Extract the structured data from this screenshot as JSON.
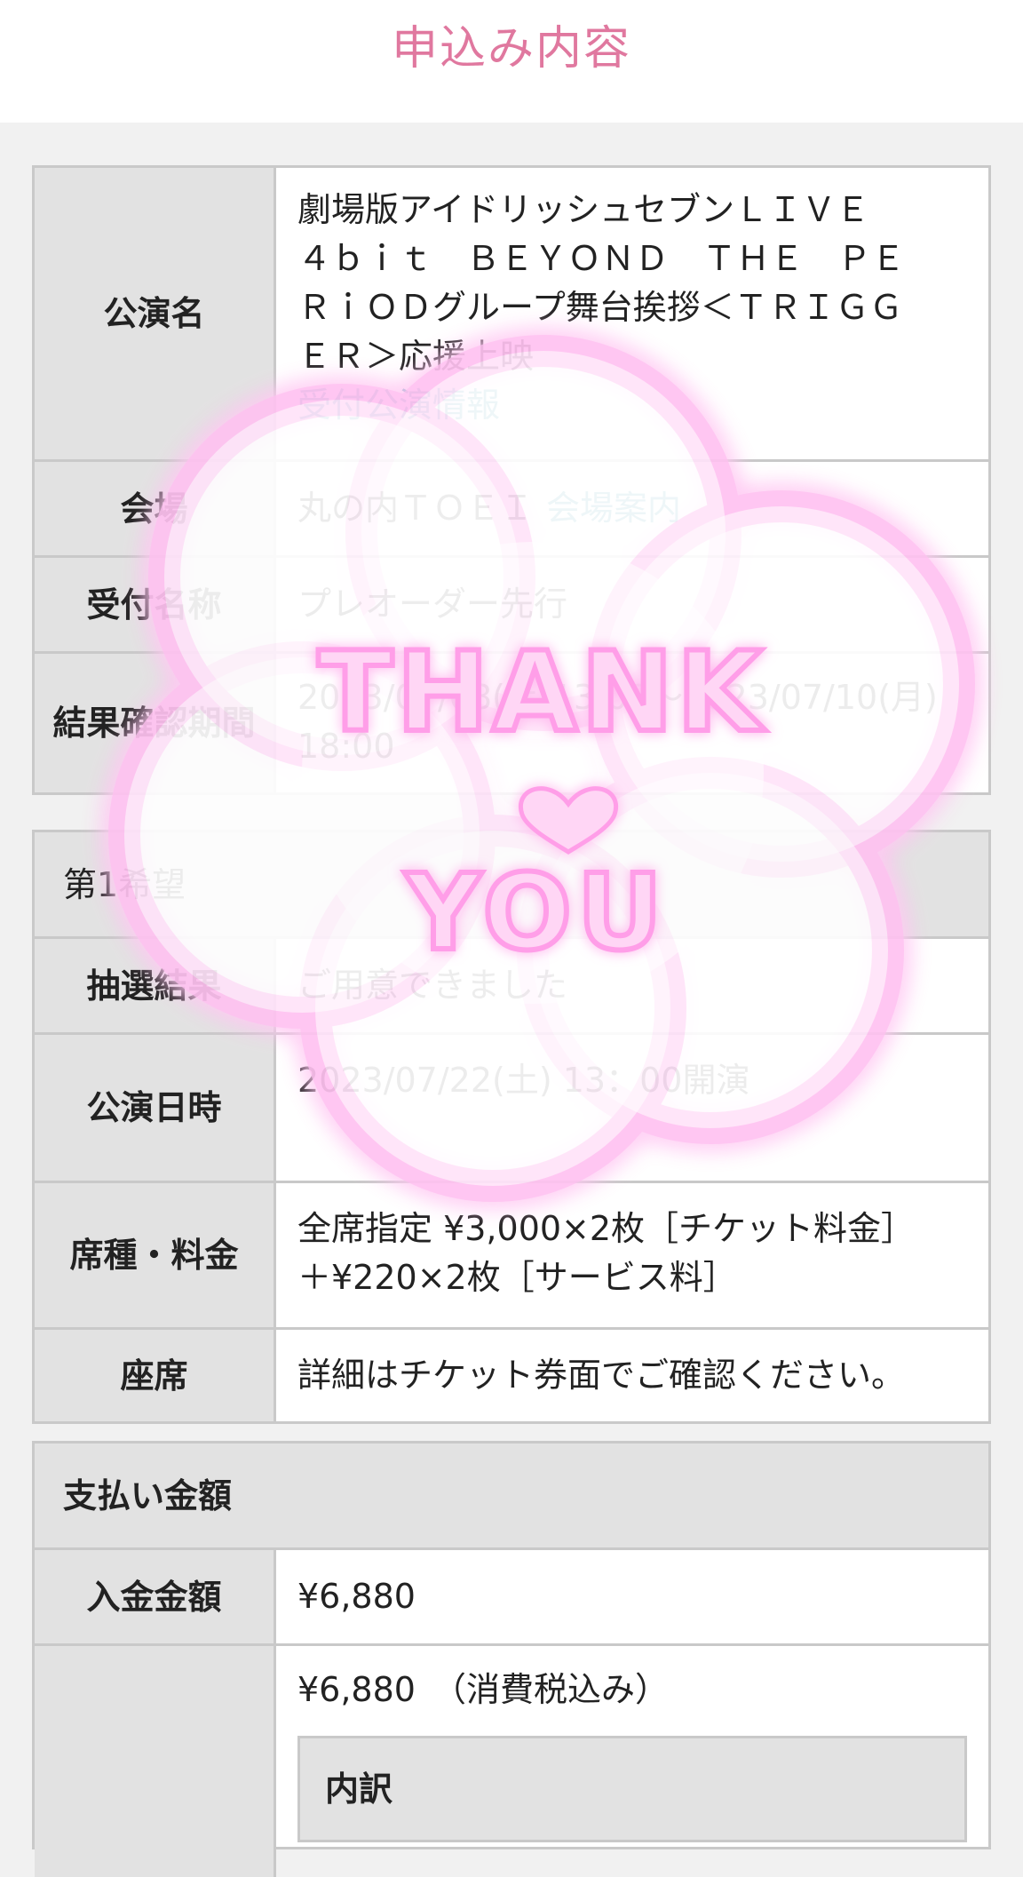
{
  "header": {
    "title": "申込み内容"
  },
  "event": {
    "title_label": "公演名",
    "title_line1": "劇場版アイドリッシュセブンＬＩＶＥ",
    "title_line2": "４ｂｉｔ　ＢＥＹＯＮＤ　ＴＨＥ　ＰＥ",
    "title_line3": "ＲｉＯＤグループ舞台挨拶＜ＴＲＩＧＧ",
    "title_line4": "ＥＲ＞応援上映",
    "detail_link": "受付公演情報",
    "venue_label": "会場",
    "venue_value": "丸の内ＴＯＥＩ",
    "venue_link": "会場案内",
    "reception_label": "受付名称",
    "reception_value": "プレオーダー先行",
    "result_label": "結果確認期間",
    "result_value_line1": "2023/07/08(土)13:00～2023/07/10(月)",
    "result_value_line2": "18:00"
  },
  "choice": {
    "heading": "第1希望",
    "lottery_label": "抽選結果",
    "lottery_value": "ご用意できました",
    "datetime_label": "公演日時",
    "datetime_value": "2023/07/22(土) 13：00開演",
    "seat_type_label": "席種・料金",
    "seat_type_line1": "全席指定 ¥3,000×2枚［チケット料金］",
    "seat_type_line2": "＋¥220×2枚［サービス料］",
    "seat_label": "座席",
    "seat_value": "詳細はチケット券面でご確認ください。"
  },
  "payment": {
    "heading": "支払い金額",
    "deposit_label": "入金金額",
    "deposit_value": "¥6,880",
    "total_value": "¥6,880　（消費税込み）",
    "breakdown_heading": "内訳"
  },
  "sticker": {
    "text_top": "THANK",
    "text_bottom": "YOU",
    "color": "#ff9ee8"
  }
}
